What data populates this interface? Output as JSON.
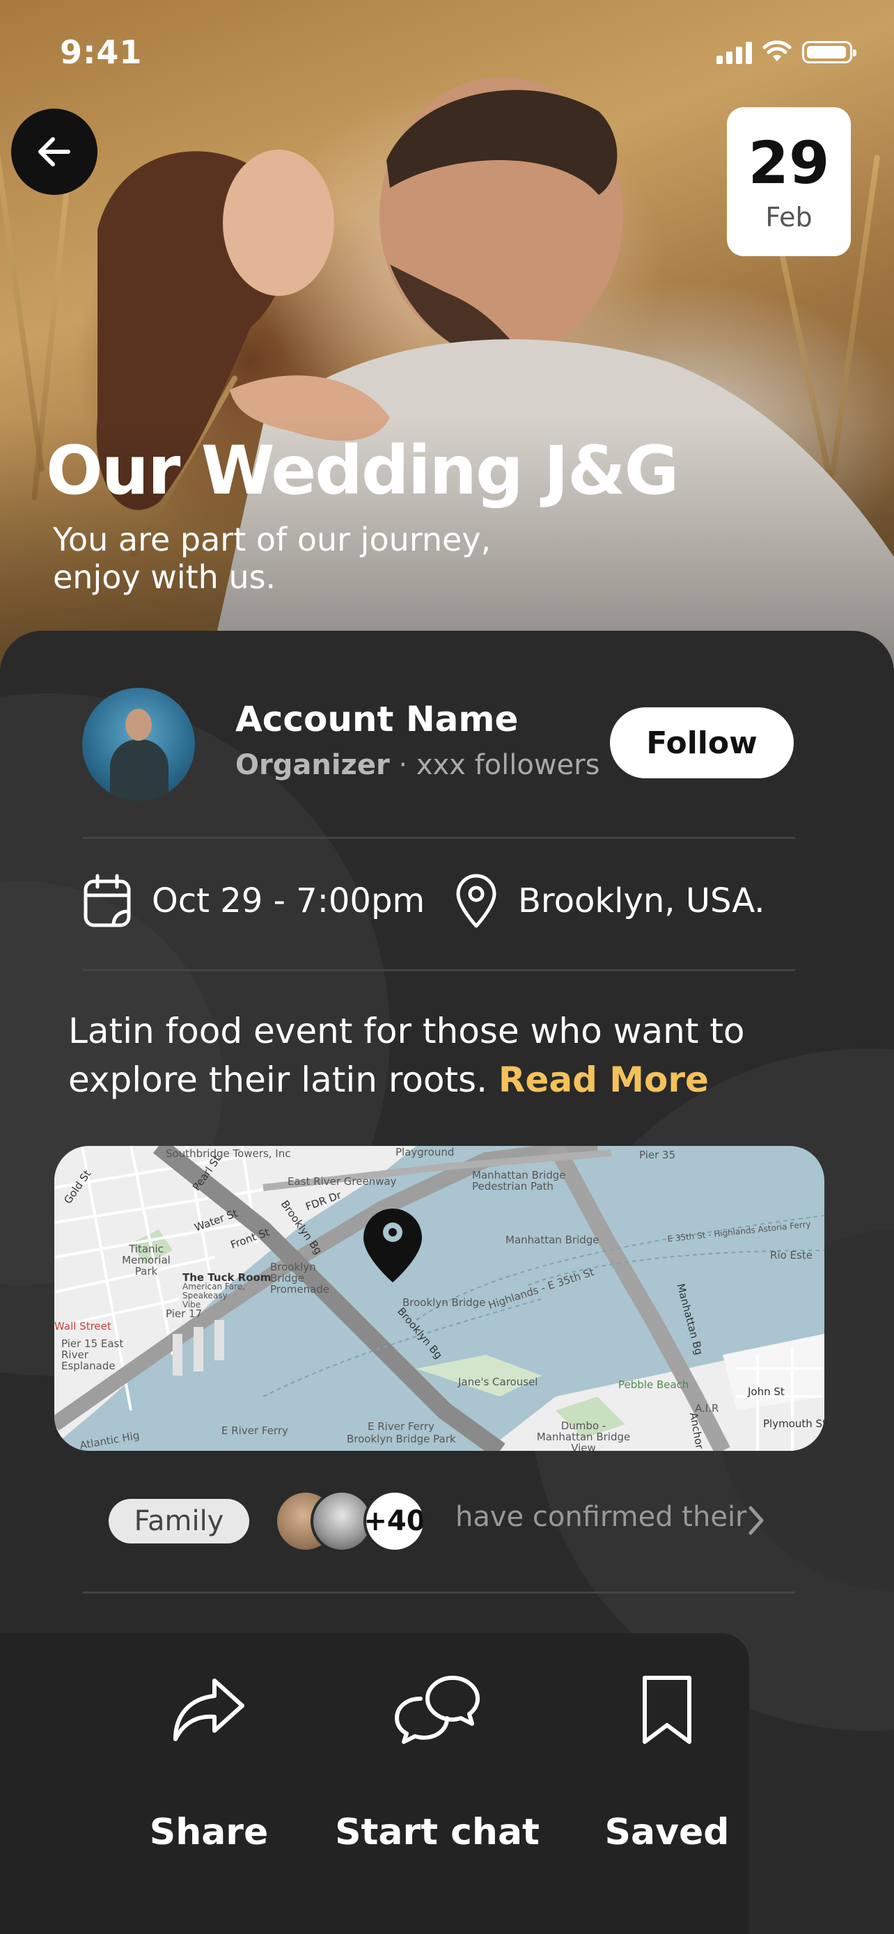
{
  "status_bar": {
    "time": "9:41"
  },
  "hero": {
    "title": "Our Wedding J&G",
    "subtitle": "You are part of our journey, enjoy with us.",
    "date_day": "29",
    "date_month": "Feb"
  },
  "organizer": {
    "name": "Account Name",
    "role": "Organizer",
    "followers": "· xxx followers",
    "follow_label": "Follow"
  },
  "event": {
    "datetime": "Oct 29 - 7:00pm",
    "location": "Brooklyn, USA.",
    "description": "Latin food event for those who want to explore their latin roots.",
    "read_more": "Read More"
  },
  "map": {
    "labels": {
      "southbridge": "Southbridge Towers, Inc",
      "playground": "Playground",
      "pier35": "Pier 35",
      "gold": "Gold St",
      "pearl": "Pearl St",
      "greenway": "East River Greenway",
      "fdr": "FDR Dr",
      "mhb_ped": "Manhattan Bridge Pedestrian Path",
      "water": "Water St",
      "front": "Front St",
      "brooklyn_bg1": "Brooklyn Bg",
      "titanic": "Titanic Memorial Park",
      "promenade": "Brooklyn Bridge Promenade",
      "mhb": "Manhattan Bridge",
      "e35": "E 35th St - Highlands Astoria Ferry",
      "rio": "Rio Este",
      "tuck": "The Tuck Room",
      "tuck_sub": "American Fare, Speakeasy Vibe",
      "brooklyn_bridge": "Brooklyn Bridge",
      "highlands": "Highlands - E 35th St",
      "pier17": "Pier 17",
      "wall": "Wall Street",
      "pier15": "Pier 15 East River Esplanade",
      "brooklyn_bg2": "Brooklyn Bg",
      "manhattan_bg": "Manhattan Bg",
      "carousel": "Jane's Carousel",
      "pebble": "Pebble Beach",
      "john": "John St",
      "air": "A.I.R",
      "erf1": "E River Ferry",
      "erf2": "E River Ferry",
      "dumbo": "Dumbo - Manhattan Bridge View",
      "plymouth": "Plymouth St",
      "bbp": "Brooklyn Bridge Park",
      "atlantic": "Atlantic Hig",
      "anchor": "Anchor"
    }
  },
  "guests": {
    "tag": "Family",
    "count": "+40",
    "text": "have confirmed their"
  },
  "actions": {
    "share": "Share",
    "chat": "Start chat",
    "saved": "Saved"
  },
  "colors": {
    "accent": "#f3c25b",
    "background": "#2a2a2a",
    "map_water": "#aac5cf"
  }
}
